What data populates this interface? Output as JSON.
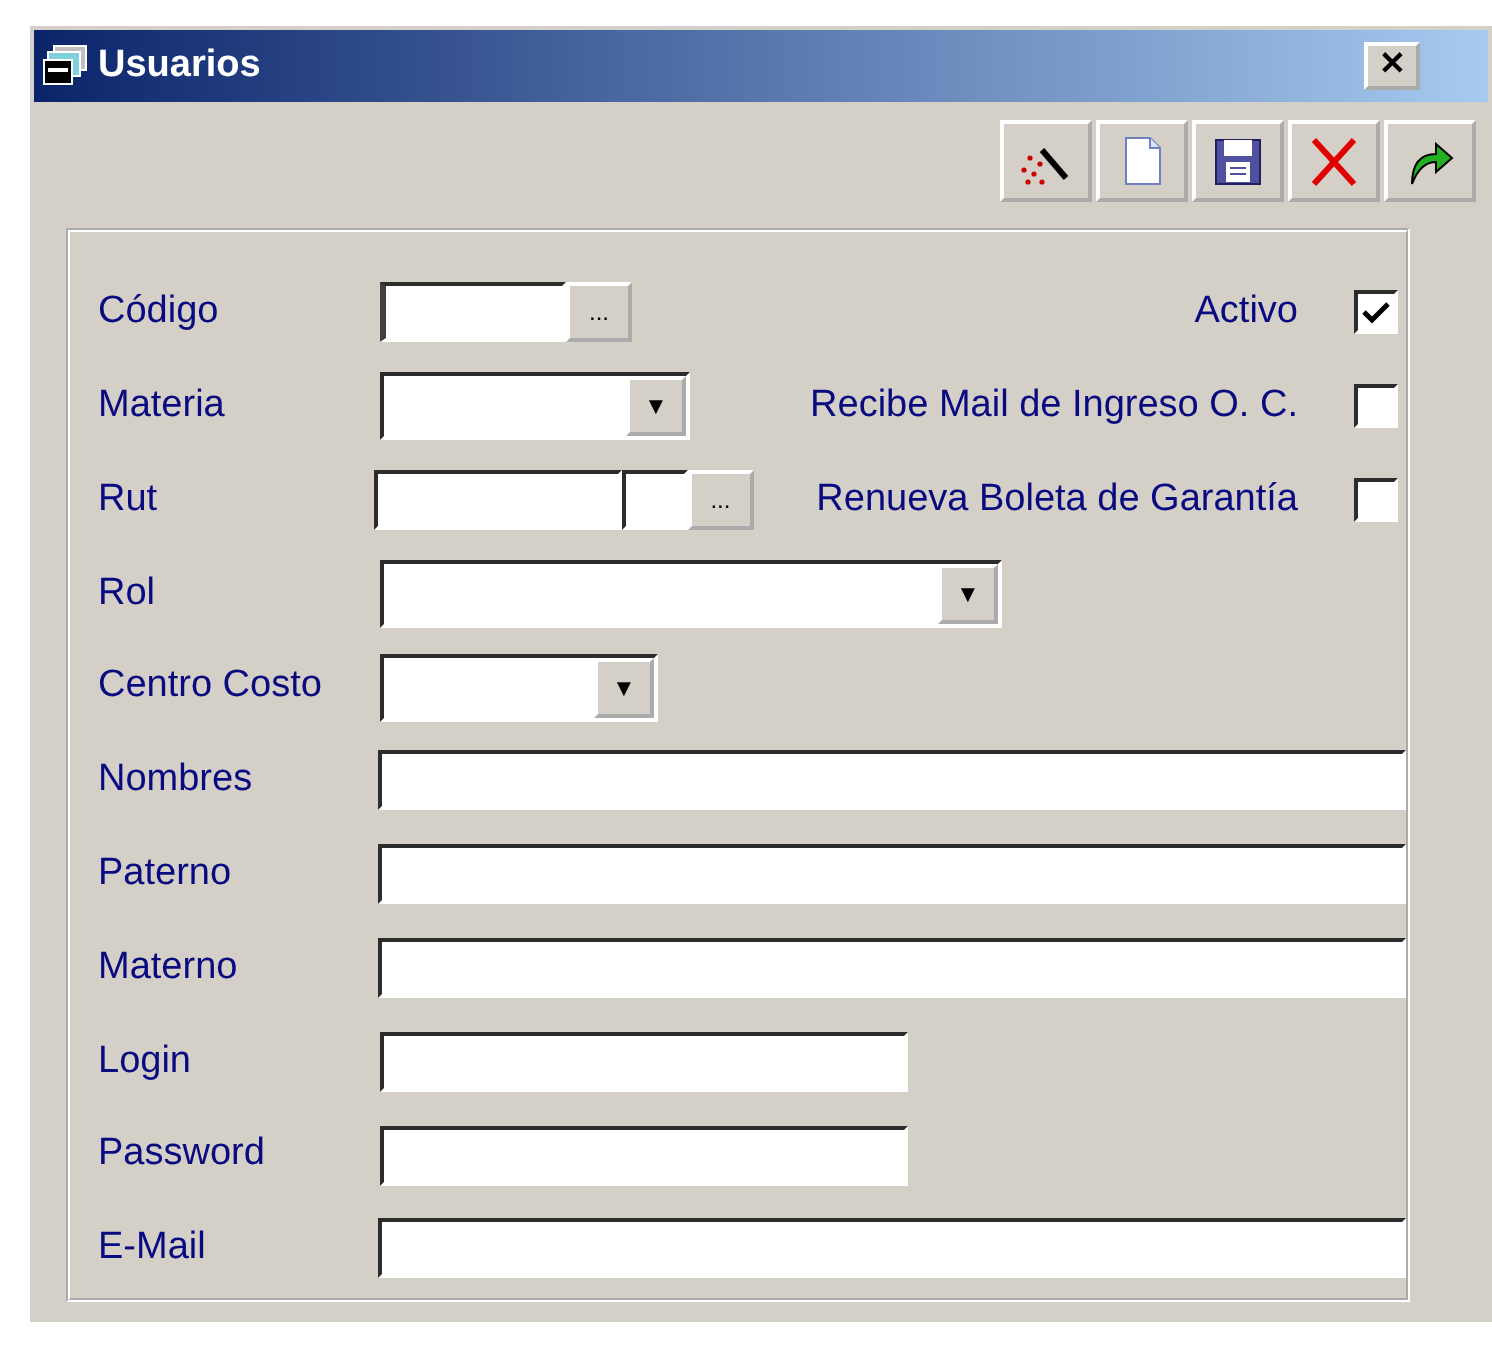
{
  "window": {
    "title": "Usuarios",
    "close": "✕"
  },
  "toolbar": [
    {
      "kind": "wand"
    },
    {
      "kind": "new"
    },
    {
      "kind": "save"
    },
    {
      "kind": "delete"
    },
    {
      "kind": "redo"
    }
  ],
  "fields": [
    {
      "label": "Código",
      "kind": "lookup",
      "focused": true
    },
    {
      "label": "Materia",
      "kind": "combo-medium"
    },
    {
      "label": "Rut",
      "kind": "rut"
    },
    {
      "label": "Rol",
      "kind": "combo-wide"
    },
    {
      "label": "Centro Costo",
      "kind": "combo-small"
    },
    {
      "label": "Nombres",
      "kind": "text-long"
    },
    {
      "label": "Paterno",
      "kind": "text-long"
    },
    {
      "label": "Materno",
      "kind": "text-long"
    },
    {
      "label": "Login",
      "kind": "text-short"
    },
    {
      "label": "Password",
      "kind": "text-short"
    },
    {
      "label": "E-Mail",
      "kind": "text-long"
    }
  ],
  "options": [
    {
      "label": "Activo",
      "checked": true
    },
    {
      "label": "Recibe Mail de Ingreso O. C.",
      "checked": false
    },
    {
      "label": "Renueva Boleta de Garantía",
      "checked": false
    }
  ],
  "lookup_button": "...",
  "dropdown_arrow": "▼"
}
